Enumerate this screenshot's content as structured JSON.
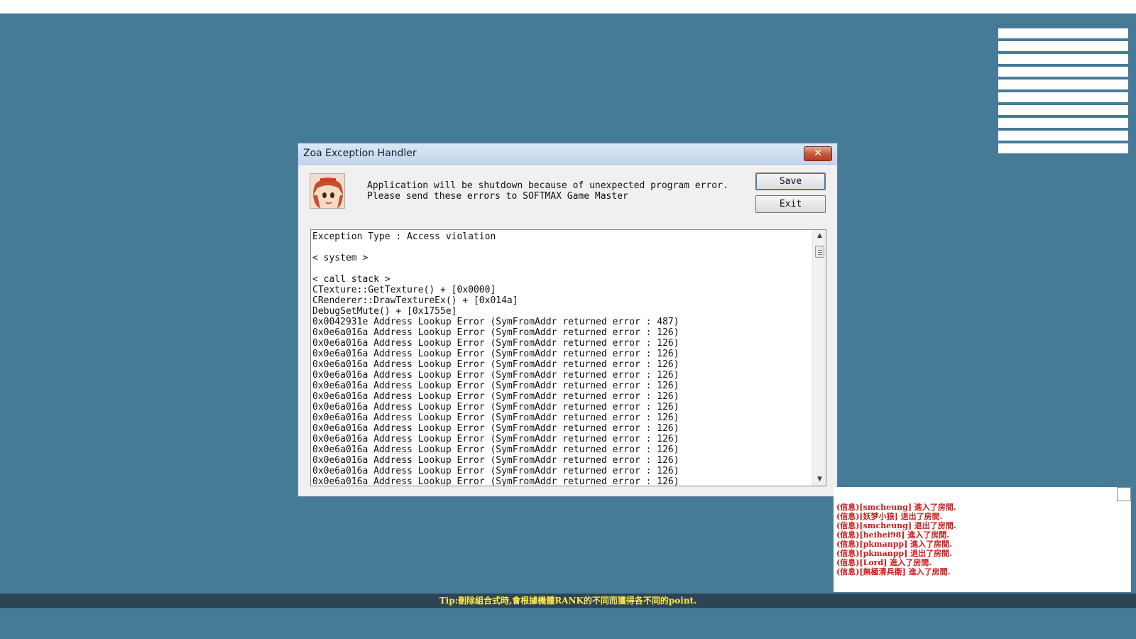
{
  "dialog": {
    "title": "Zoa Exception Handler",
    "close_glyph": "✕",
    "message_line1": "Application will be shutdown because of unexpected program error.",
    "message_line2": "Please send these errors to SOFTMAX Game Master",
    "save_label": "Save",
    "exit_label": "Exit",
    "log_lines": [
      "Exception Type : Access violation",
      "",
      "< system >",
      "",
      "< call stack >",
      "CTexture::GetTexture() + [0x0000]",
      "CRenderer::DrawTextureEx() + [0x014a]",
      "DebugSetMute() + [0x1755e]",
      "0x0042931e Address Lookup Error (SymFromAddr returned error : 487)",
      "0x0e6a016a Address Lookup Error (SymFromAddr returned error : 126)",
      "0x0e6a016a Address Lookup Error (SymFromAddr returned error : 126)",
      "0x0e6a016a Address Lookup Error (SymFromAddr returned error : 126)",
      "0x0e6a016a Address Lookup Error (SymFromAddr returned error : 126)",
      "0x0e6a016a Address Lookup Error (SymFromAddr returned error : 126)",
      "0x0e6a016a Address Lookup Error (SymFromAddr returned error : 126)",
      "0x0e6a016a Address Lookup Error (SymFromAddr returned error : 126)",
      "0x0e6a016a Address Lookup Error (SymFromAddr returned error : 126)",
      "0x0e6a016a Address Lookup Error (SymFromAddr returned error : 126)",
      "0x0e6a016a Address Lookup Error (SymFromAddr returned error : 126)",
      "0x0e6a016a Address Lookup Error (SymFromAddr returned error : 126)",
      "0x0e6a016a Address Lookup Error (SymFromAddr returned error : 126)",
      "0x0e6a016a Address Lookup Error (SymFromAddr returned error : 126)",
      "0x0e6a016a Address Lookup Error (SymFromAddr returned error : 126)",
      "0x0e6a016a Address Lookup Error (SymFromAddr returned error : 126)"
    ]
  },
  "chat": {
    "lines": [
      "(信息)[smcheung] 進入了房間.",
      "(信息)[妖梦小狼] 退出了房間.",
      "(信息)[smcheung] 退出了房間.",
      "(信息)[heihei98] 進入了房間.",
      "(信息)[pkmanpp] 進入了房間.",
      "(信息)[pkmanpp] 退出了房間.",
      "(信息)[Lord] 進入了房間.",
      "(信息)[無極清兵衛] 進入了房間."
    ]
  },
  "tip": {
    "text": "Tip:刪除組合式時,會根據機體RANK的不同而獲得各不同的point."
  },
  "icons": {
    "scroll_up": "▲",
    "scroll_down": "▼"
  },
  "colors": {
    "background": "#467b98",
    "chat_text": "#cc1a1a",
    "tip_text": "#ffe94a"
  }
}
